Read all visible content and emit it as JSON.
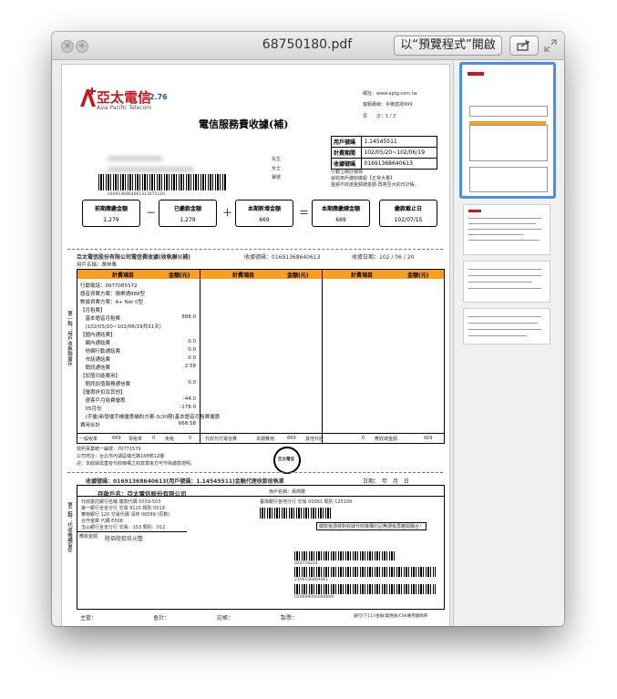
{
  "window": {
    "title": "68750180.pdf",
    "open_with_button": "以“預覽程式”開啟",
    "close_glyph": "×",
    "add_glyph": "+"
  },
  "icons": {
    "close": "close-icon",
    "add": "add-icon",
    "share": "share-icon",
    "fullscreen": "fullscreen-icon"
  },
  "colors": {
    "accent_orange": "#f5a023",
    "brand_red": "#c8161d",
    "selection_blue": "#4a90e2"
  },
  "bill": {
    "logo_name": "亞太電信",
    "logo_sub": "Asia Pacific Telecom",
    "logo_badge": "2.76",
    "website": "網址：www.aptg.com.tw",
    "service_line": "客服專線：手機直撥999",
    "page": "頁　　次：1 / 2",
    "title": "電信服務費收據(補)",
    "account_label": "用戶號碼",
    "account_value": "1.14545511",
    "period_label": "計費期間",
    "period_value": "102/05/20~102/06/19",
    "receipt_label": "收據號碼",
    "receipt_value": "01691368640613",
    "note_line1": "行動上網計價標",
    "note_line2": "就收用戶繳約繳超【正常大量】",
    "note_line3": "金額不收謝金額總金額 再寄至大約日計帳。",
    "addr_side1": "先生",
    "addr_side2": "女士",
    "addr_side3": "寶號",
    "barcode_text": "0169136864061313071120",
    "sum_prev_label": "前期應繳金額",
    "sum_prev_value": "1,279",
    "sum_paid_label": "已繳款金額",
    "sum_paid_value": "1,279",
    "sum_new_label": "本期新增金額",
    "sum_new_value": "669",
    "sum_due_label": "本期應繳總金額",
    "sum_due_value": "669",
    "sum_deadline_label": "繳款截止日",
    "sum_deadline_value": "102/07/15",
    "op_minus": "－",
    "op_plus": "＋",
    "op_equal": "＝"
  },
  "section2": {
    "company": "亞太電信股份有限公司電信費收據(收執聯)(補)",
    "receipt_no": "收據號碼：01691368640613",
    "receipt_date": "收據日期：102 / 06 / 20",
    "customer": "用戶名稱：黃柿雅",
    "side_label": "第一聯：用戶收執聯留存",
    "col_item": "計費項目",
    "col_amount": "金額(元)",
    "lines": [
      {
        "text": "行動電話：0977085572",
        "amt": ""
      },
      {
        "text": "語音資費方案：微樂通888型",
        "amt": ""
      },
      {
        "text": "數據資費方案：A+ Net 0型",
        "amt": ""
      },
      {
        "text": "【月租費】",
        "amt": ""
      },
      {
        "text": "　基本語音月租費",
        "amt": "888.0"
      },
      {
        "text": "　(102/05/20~102/06/19共31天)",
        "amt": ""
      },
      {
        "text": "【國內通話費】",
        "amt": ""
      },
      {
        "text": "　網內通話費",
        "amt": "0.0"
      },
      {
        "text": "　他網行動通話費",
        "amt": "0.0"
      },
      {
        "text": "　市話通話費",
        "amt": "0.0"
      },
      {
        "text": "　簡訊通信費",
        "amt": "2.58"
      },
      {
        "text": "【加值功能費用】",
        "amt": ""
      },
      {
        "text": "　簡訊加值服務通信費",
        "amt": "0.0"
      },
      {
        "text": "【優惠折扣及其他】",
        "amt": ""
      },
      {
        "text": "　速客戶月租費優惠",
        "amt": "-44.0"
      },
      {
        "text": "　05月份",
        "amt": "-178.0"
      },
      {
        "text": "　(手優)新發優手機優惠補約方案-3(30期)基本語音月租費優惠",
        "amt": ""
      },
      {
        "text": "費用合計",
        "amt": "668.58"
      }
    ],
    "footer_general": "一般稅率",
    "footer_general_val": "669",
    "footer_zero": "零稅率",
    "footer_zero_val": "0",
    "footer_exempt": "免稅",
    "footer_exempt_val": "0",
    "footer_collect": "代收代付電信費",
    "footer_current": "本期費用",
    "footer_current_val": "669",
    "footer_other": "其他代收",
    "footer_other_val": "0",
    "footer_total": "應收總金額",
    "footer_total_val": "669",
    "unified_no": "營利事業統一編號：70771579",
    "company_addr": "公司地址：台北市內湖區瑞光路188號12樓",
    "note": "註：本收據需蓋有代收機構之收款章後方可作為繳款證明。",
    "stamp_text": "亞太電信"
  },
  "section3": {
    "header": "收據號碼：01691368640613(用戶號碼：1.14545511)金融代理收款收執單",
    "date_label": "日期：　年　月　日",
    "payee": "存款戶名：亞太電信股份有限公司",
    "side_label": "第二聯：代收機構留存",
    "bank_lines": [
      "代收委託銀行名稱 繳款代碼 0039-503",
      "第一銀行全省分行 交易 9115 類別 0019",
      "華南銀行 120 交易代碼 清存 06589 (頁數)",
      "合作金庫 代碼 E008",
      "玉山銀行全省分行 交易：153 類別：012"
    ],
    "right_header": "臺灣銀行各地分行 交易 00061 類別 125100",
    "user_name": "用戶名稱：黃柿雅",
    "warning": "繳款後請核對收據代收機構印記無誤後再離開櫃台！",
    "receive_label": "應收金額",
    "amount_note": "陸佰陸拾玖元整",
    "barcode_1": "020710224",
    "barcode_2": "2100136864061",
    "barcode_3": "020669000000669",
    "footer_supervisor": "主管：",
    "footer_accounting": "會計：",
    "footer_bookkeeper": "記帳：",
    "footer_cashier": "製票：",
    "footer_right": "銀行(下11)/金融/業務員/CSK專用繳碼單"
  }
}
